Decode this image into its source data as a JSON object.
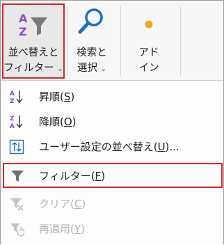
{
  "ribbon": {
    "sort_filter": {
      "line1": "並べ替えと",
      "line2": "フィルター",
      "chevron": "⌄",
      "icon": "sort-az-filter-icon"
    },
    "find_select": {
      "line1": "検索と",
      "line2": "選択",
      "chevron": "⌄",
      "icon": "magnifier-icon"
    },
    "addin": {
      "line1": "アド",
      "line2": "イン",
      "icon": "addin-dot-icon",
      "accent": "#f5a623"
    }
  },
  "menu": {
    "items": [
      {
        "label": "昇順(",
        "key": "S",
        "suffix": ")",
        "icon": "sort-ascending-icon",
        "enabled": true
      },
      {
        "label": "降順(",
        "key": "O",
        "suffix": ")",
        "icon": "sort-descending-icon",
        "enabled": true
      },
      {
        "label": "ユーザー設定の並べ替え(",
        "key": "U",
        "suffix": ")...",
        "icon": "custom-sort-icon",
        "enabled": true
      },
      {
        "label": "フィルター(",
        "key": "F",
        "suffix": ")",
        "icon": "filter-funnel-icon",
        "enabled": true,
        "highlighted": true
      },
      {
        "label": "クリア(",
        "key": "C",
        "suffix": ")",
        "icon": "clear-filter-icon",
        "enabled": false
      },
      {
        "label": "再適用(",
        "key": "Y",
        "suffix": ")",
        "icon": "reapply-icon",
        "enabled": false
      }
    ]
  },
  "colors": {
    "highlight_border": "#d9242b",
    "icon_blue": "#1e6fc1",
    "icon_purple": "#8a4fbf"
  }
}
